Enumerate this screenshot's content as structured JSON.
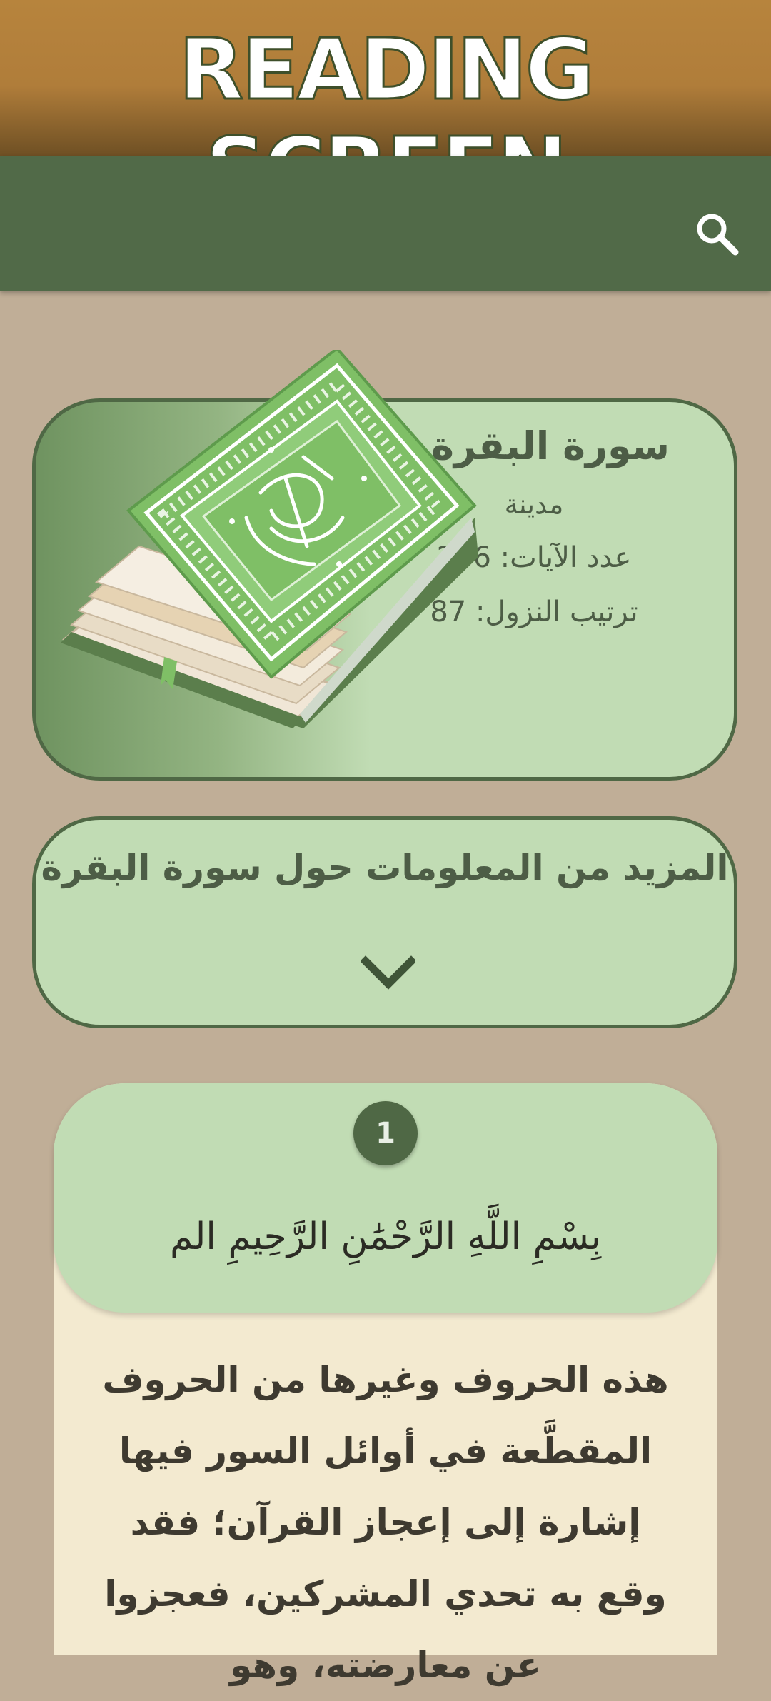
{
  "banner": {
    "title": "READING SCREEN"
  },
  "toolbar": {
    "search_icon": "search-icon"
  },
  "surah": {
    "name": "سورة البقرة",
    "type": "مدينة",
    "verses_text": "عدد الآيات: 286",
    "order_text": "ترتيب النزول: 87",
    "image_icon": "mushaf-book-illustration"
  },
  "more_info": {
    "title": "المزيد من المعلومات حول سورة البقرة",
    "icon": "chevron-down-icon"
  },
  "ayah": {
    "number": "1",
    "text": "بِسْمِ اللَّهِ الرَّحْمَٰنِ الرَّحِيمِ الم",
    "tafsir": "هذه الحروف وغيرها من الحروف المقطَّعة في أوائل السور فيها إشارة إلى إعجاز القرآن؛ فقد وقع به تحدي المشركين، فعجزوا عن معارضته، وهو"
  },
  "colors": {
    "banner": "#b7843d",
    "toolbar": "#516a48",
    "background": "#c0ae97",
    "card_green": "#c1dcb4",
    "card_border": "#4f6845",
    "tafsir_bg": "#f3ead0"
  }
}
